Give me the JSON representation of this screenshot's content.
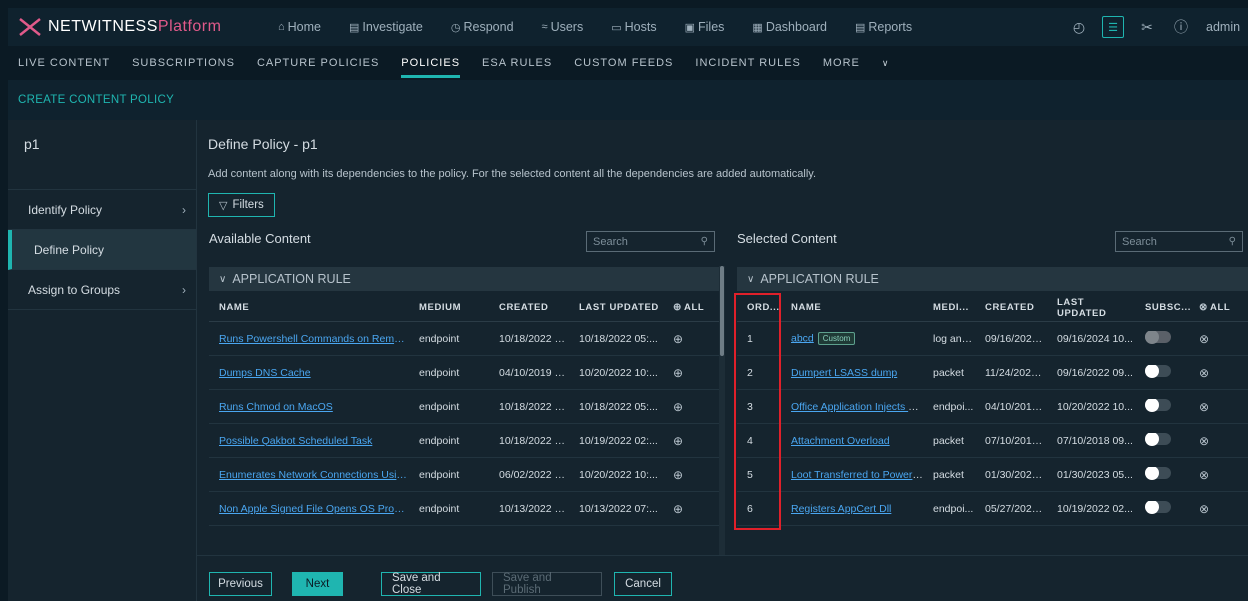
{
  "app": {
    "brand_name": "NETWITNESS",
    "brand_suffix": "Platform"
  },
  "main_nav": [
    {
      "label": "Home",
      "icon": "home-icon",
      "glyph": "⌂"
    },
    {
      "label": "Investigate",
      "icon": "investigate-icon",
      "glyph": "▤"
    },
    {
      "label": "Respond",
      "icon": "respond-icon",
      "glyph": "◷"
    },
    {
      "label": "Users",
      "icon": "users-icon",
      "glyph": "≈"
    },
    {
      "label": "Hosts",
      "icon": "hosts-icon",
      "glyph": "▭"
    },
    {
      "label": "Files",
      "icon": "files-icon",
      "glyph": "▣"
    },
    {
      "label": "Dashboard",
      "icon": "dashboard-icon",
      "glyph": "▦"
    },
    {
      "label": "Reports",
      "icon": "reports-icon",
      "glyph": "▤"
    }
  ],
  "top_right": {
    "user": "admin",
    "icons": [
      "timer-icon",
      "admin-panel-icon",
      "tools-icon",
      "help-icon"
    ]
  },
  "sub_nav": [
    "LIVE CONTENT",
    "SUBSCRIPTIONS",
    "CAPTURE POLICIES",
    "POLICIES",
    "ESA RULES",
    "CUSTOM FEEDS",
    "INCIDENT RULES",
    "MORE"
  ],
  "sub_nav_active": "POLICIES",
  "create_link": "CREATE CONTENT POLICY",
  "sidebar": {
    "policy_name": "p1",
    "steps": [
      {
        "label": "Identify Policy",
        "active": false
      },
      {
        "label": "Define Policy",
        "active": true
      },
      {
        "label": "Assign to Groups",
        "active": false
      }
    ]
  },
  "main": {
    "title": "Define Policy - p1",
    "description": "Add content along with its dependencies to the policy. For the selected content all the dependencies are added automatically.",
    "filters_label": "Filters"
  },
  "available": {
    "title": "Available Content",
    "search_placeholder": "Search",
    "group": "APPLICATION RULE",
    "columns": [
      "NAME",
      "MEDIUM",
      "CREATED",
      "LAST UPDATED",
      "ALL"
    ],
    "rows": [
      {
        "name": "Runs Powershell Commands on Remote ...",
        "medium": "endpoint",
        "created": "10/18/2022 0...",
        "updated": "10/18/2022 05:..."
      },
      {
        "name": "Dumps DNS Cache",
        "medium": "endpoint",
        "created": "04/10/2019 0...",
        "updated": "10/20/2022 10:..."
      },
      {
        "name": "Runs Chmod on MacOS",
        "medium": "endpoint",
        "created": "10/18/2022 0...",
        "updated": "10/18/2022 05:..."
      },
      {
        "name": "Possible Qakbot Scheduled Task",
        "medium": "endpoint",
        "created": "10/18/2022 0...",
        "updated": "10/19/2022 02:..."
      },
      {
        "name": "Enumerates Network Connections Usin...",
        "medium": "endpoint",
        "created": "06/02/2022 0...",
        "updated": "10/20/2022 10:..."
      },
      {
        "name": "Non Apple Signed File Opens OS Process",
        "medium": "endpoint",
        "created": "10/13/2022 0...",
        "updated": "10/13/2022 07:..."
      }
    ]
  },
  "selected": {
    "title": "Selected Content",
    "search_placeholder": "Search",
    "group": "APPLICATION RULE",
    "columns": [
      "ORD...",
      "NAME",
      "MEDI...",
      "CREATED",
      "LAST UPDATED",
      "SUBSC...",
      "ALL"
    ],
    "custom_badge": "Custom",
    "rows": [
      {
        "order": "1",
        "name": "abcd",
        "custom": true,
        "medium": "log and...",
        "created": "09/16/2024 ...",
        "updated": "09/16/2024 10...",
        "subscribed_disabled": true
      },
      {
        "order": "2",
        "name": "Dumpert LSASS dump",
        "custom": false,
        "medium": "packet",
        "created": "11/24/2021 ...",
        "updated": "09/16/2022 09...",
        "subscribed_disabled": false
      },
      {
        "order": "3",
        "name": "Office Application Injects Re...",
        "custom": false,
        "medium": "endpoi...",
        "created": "04/10/2019 ...",
        "updated": "10/20/2022 10...",
        "subscribed_disabled": false
      },
      {
        "order": "4",
        "name": "Attachment Overload",
        "custom": false,
        "medium": "packet",
        "created": "07/10/2018 ...",
        "updated": "07/10/2018 09...",
        "subscribed_disabled": false
      },
      {
        "order": "5",
        "name": "Loot Transferred to PowerH...",
        "custom": false,
        "medium": "packet",
        "created": "01/30/2023 ...",
        "updated": "01/30/2023 05...",
        "subscribed_disabled": false
      },
      {
        "order": "6",
        "name": "Registers AppCert Dll",
        "custom": false,
        "medium": "endpoi...",
        "created": "05/27/2021 ...",
        "updated": "10/19/2022 02...",
        "subscribed_disabled": false
      }
    ]
  },
  "footer": {
    "previous": "Previous",
    "next": "Next",
    "save_close": "Save and Close",
    "save_publish": "Save and Publish",
    "cancel": "Cancel"
  },
  "colors": {
    "accent": "#1fb5b0",
    "link": "#4aa6f0",
    "highlight": "#e0202a",
    "brand_suffix": "#e05a8a"
  }
}
